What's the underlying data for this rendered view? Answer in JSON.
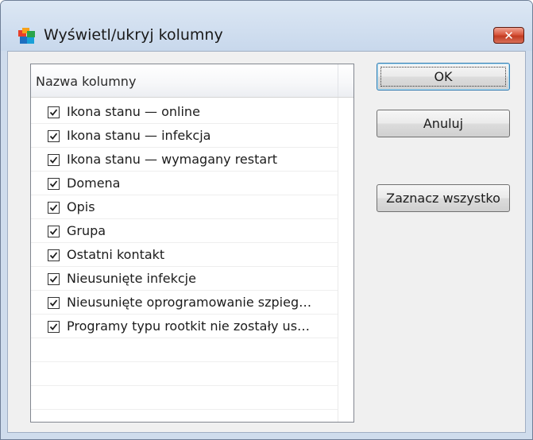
{
  "window": {
    "title": "Wyświetl/ukryj kolumny",
    "close_symbol": "✕"
  },
  "list": {
    "column_header": "Nazwa kolumny",
    "items": [
      {
        "label": "Ikona stanu — online",
        "checked": true
      },
      {
        "label": "Ikona stanu — infekcja",
        "checked": true
      },
      {
        "label": "Ikona stanu — wymagany restart",
        "checked": true
      },
      {
        "label": "Domena",
        "checked": true
      },
      {
        "label": "Opis",
        "checked": true
      },
      {
        "label": "Grupa",
        "checked": true
      },
      {
        "label": "Ostatni kontakt",
        "checked": true
      },
      {
        "label": "Nieusunięte infekcje",
        "checked": true
      },
      {
        "label": "Nieusunięte oprogramowanie szpieg…",
        "checked": true
      },
      {
        "label": "Programy typu rootkit nie zostały us…",
        "checked": true
      }
    ]
  },
  "buttons": {
    "ok": "OK",
    "cancel": "Anuluj",
    "select_all": "Zaznacz wszystko"
  },
  "colors": {
    "accent": "#3c7fb1",
    "close": "#c23c22"
  }
}
